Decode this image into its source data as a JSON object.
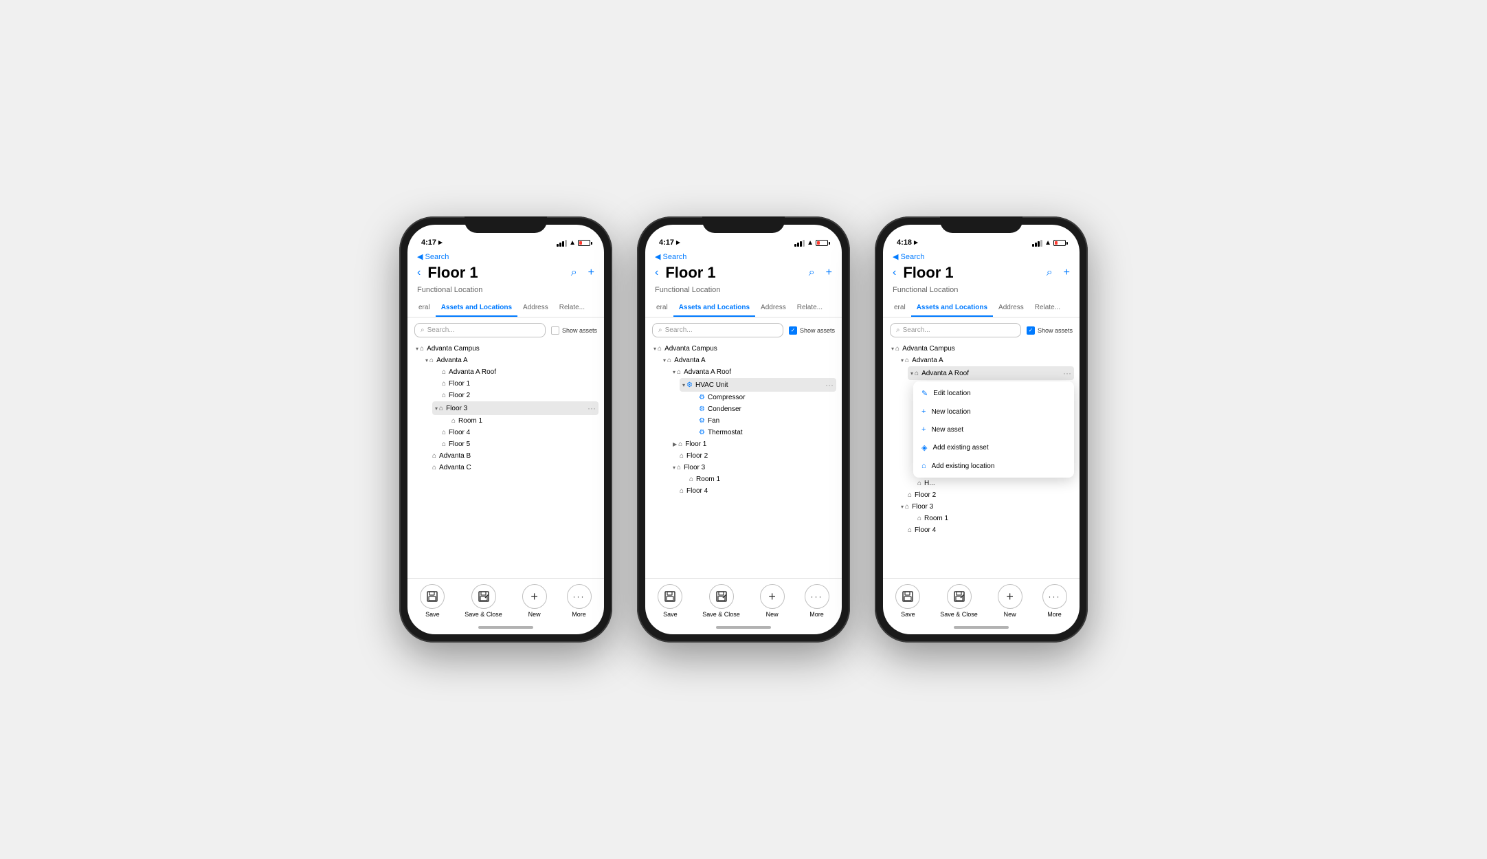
{
  "phones": [
    {
      "id": "phone1",
      "time": "4:17",
      "back_label": "◀ Search",
      "title": "Floor 1",
      "subtitle": "Functional Location",
      "tabs": [
        "eral",
        "Assets and Locations",
        "Address",
        "Relate..."
      ],
      "active_tab": 1,
      "search_placeholder": "Search...",
      "show_assets_checked": false,
      "show_assets_label": "Show assets",
      "battery_level": "low",
      "tree": [
        {
          "level": 0,
          "type": "loc",
          "label": "Advanta Campus",
          "expanded": true,
          "chevron": "▾"
        },
        {
          "level": 1,
          "type": "loc",
          "label": "Advanta A",
          "expanded": true,
          "chevron": "▾"
        },
        {
          "level": 2,
          "type": "loc",
          "label": "Advanta A Roof",
          "expanded": false
        },
        {
          "level": 2,
          "type": "loc",
          "label": "Floor 1",
          "expanded": false
        },
        {
          "level": 2,
          "type": "loc",
          "label": "Floor 2",
          "expanded": false
        },
        {
          "level": 2,
          "type": "loc",
          "label": "Floor 3",
          "expanded": true,
          "chevron": "▾",
          "highlighted": true,
          "more": true
        },
        {
          "level": 3,
          "type": "loc",
          "label": "Room 1",
          "expanded": false
        },
        {
          "level": 2,
          "type": "loc",
          "label": "Floor 4",
          "expanded": false
        },
        {
          "level": 2,
          "type": "loc",
          "label": "Floor 5",
          "expanded": false
        },
        {
          "level": 1,
          "type": "loc",
          "label": "Advanta B",
          "expanded": false
        },
        {
          "level": 1,
          "type": "loc",
          "label": "Advanta C",
          "expanded": false
        }
      ],
      "toolbar": [
        {
          "icon": "💾",
          "label": "Save"
        },
        {
          "icon": "📋",
          "label": "Save & Close"
        },
        {
          "icon": "+",
          "label": "New"
        },
        {
          "icon": "···",
          "label": "More"
        }
      ]
    },
    {
      "id": "phone2",
      "time": "4:17",
      "back_label": "◀ Search",
      "title": "Floor 1",
      "subtitle": "Functional Location",
      "tabs": [
        "eral",
        "Assets and Locations",
        "Address",
        "Relate..."
      ],
      "active_tab": 1,
      "search_placeholder": "Search...",
      "show_assets_checked": true,
      "show_assets_label": "Show assets",
      "battery_level": "low",
      "tree": [
        {
          "level": 0,
          "type": "loc",
          "label": "Advanta Campus",
          "expanded": true,
          "chevron": "▾"
        },
        {
          "level": 1,
          "type": "loc",
          "label": "Advanta A",
          "expanded": true,
          "chevron": "▾"
        },
        {
          "level": 2,
          "type": "loc",
          "label": "Advanta A Roof",
          "expanded": true,
          "chevron": "▾"
        },
        {
          "level": 3,
          "type": "asset",
          "label": "HVAC Unit",
          "expanded": true,
          "chevron": "▾",
          "highlighted": true,
          "more": true
        },
        {
          "level": 4,
          "type": "asset",
          "label": "Compressor"
        },
        {
          "level": 4,
          "type": "asset",
          "label": "Condenser"
        },
        {
          "level": 4,
          "type": "asset",
          "label": "Fan"
        },
        {
          "level": 4,
          "type": "asset",
          "label": "Thermostat"
        },
        {
          "level": 2,
          "type": "loc",
          "label": "Floor 1",
          "expanded": false,
          "chevron": "▶"
        },
        {
          "level": 2,
          "type": "loc",
          "label": "Floor 2",
          "expanded": false
        },
        {
          "level": 2,
          "type": "loc",
          "label": "Floor 3",
          "expanded": true,
          "chevron": "▾"
        },
        {
          "level": 3,
          "type": "loc",
          "label": "Room 1"
        },
        {
          "level": 2,
          "type": "loc",
          "label": "Floor 4"
        }
      ],
      "toolbar": [
        {
          "icon": "💾",
          "label": "Save"
        },
        {
          "icon": "📋",
          "label": "Save & Close"
        },
        {
          "icon": "+",
          "label": "New"
        },
        {
          "icon": "···",
          "label": "More"
        }
      ]
    },
    {
      "id": "phone3",
      "time": "4:18",
      "back_label": "◀ Search",
      "title": "Floor 1",
      "subtitle": "Functional Location",
      "tabs": [
        "eral",
        "Assets and Locations",
        "Address",
        "Relate..."
      ],
      "active_tab": 1,
      "search_placeholder": "Search...",
      "show_assets_checked": true,
      "show_assets_label": "Show assets",
      "battery_level": "low",
      "tree": [
        {
          "level": 0,
          "type": "loc",
          "label": "Advanta Campus",
          "expanded": true,
          "chevron": "▾"
        },
        {
          "level": 1,
          "type": "loc",
          "label": "Advanta A",
          "expanded": true,
          "chevron": "▾"
        },
        {
          "level": 2,
          "type": "loc",
          "label": "Advanta A Roof",
          "expanded": true,
          "chevron": "▾",
          "highlighted": true,
          "more": true
        }
      ],
      "context_menu": [
        {
          "icon": "✏️",
          "label": "Edit location"
        },
        {
          "icon": "➕",
          "label": "New location"
        },
        {
          "icon": "➕",
          "label": "New asset"
        },
        {
          "icon": "📦",
          "label": "Add existing asset"
        },
        {
          "icon": "📍",
          "label": "Add existing location"
        }
      ],
      "tree_after_menu": [
        {
          "level": 2,
          "type": "loc",
          "label": "H...",
          "expanded": false
        },
        {
          "level": 1,
          "type": "loc",
          "label": "Floor 2",
          "expanded": false
        },
        {
          "level": 1,
          "type": "loc",
          "label": "Floor 3",
          "expanded": true,
          "chevron": "▾"
        },
        {
          "level": 2,
          "type": "loc",
          "label": "Room 1"
        },
        {
          "level": 1,
          "type": "loc",
          "label": "Floor 4"
        }
      ],
      "toolbar": [
        {
          "icon": "💾",
          "label": "Save"
        },
        {
          "icon": "📋",
          "label": "Save & Close"
        },
        {
          "icon": "+",
          "label": "New"
        },
        {
          "icon": "···",
          "label": "More"
        }
      ]
    }
  ]
}
